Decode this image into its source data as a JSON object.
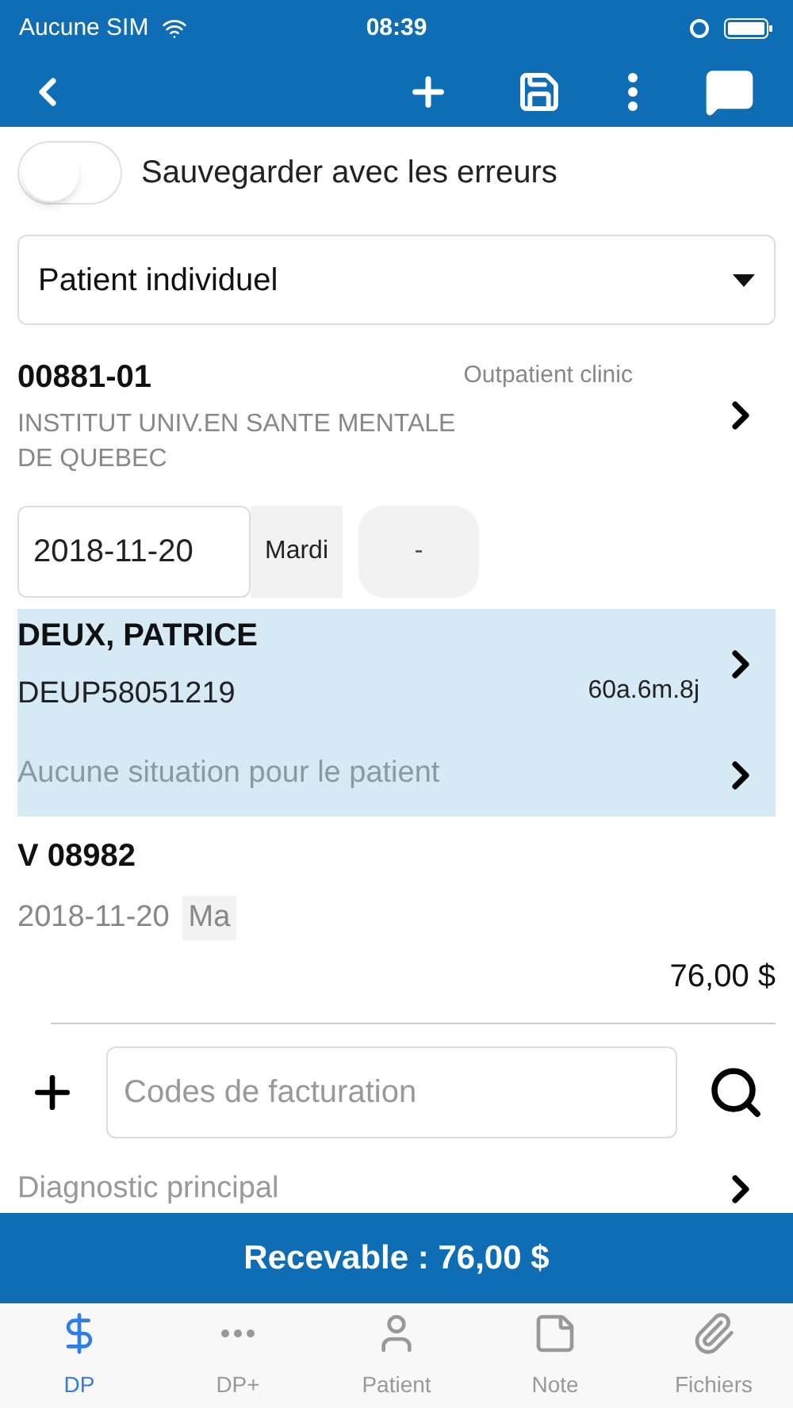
{
  "status_bar": {
    "carrier": "Aucune SIM",
    "time": "08:39"
  },
  "toggle": {
    "label": "Sauvegarder avec les erreurs",
    "on": false
  },
  "dropdown": {
    "value": "Patient individuel"
  },
  "establishment": {
    "code": "00881-01",
    "type": "Outpatient clinic",
    "name": "INSTITUT UNIV.EN SANTE MENTALE\nDE QUEBEC"
  },
  "date": {
    "value": "2018-11-20",
    "weekday": "Mardi",
    "slot": "-"
  },
  "patient": {
    "name": "DEUX, PATRICE",
    "id": "DEUP58051219",
    "age": "60a.6m.8j",
    "situation_placeholder": "Aucune situation pour le patient"
  },
  "visit": {
    "number": "V 08982",
    "date": "2018-11-20",
    "day": "Ma",
    "amount": "76,00 $"
  },
  "billing_codes": {
    "placeholder": "Codes de facturation"
  },
  "diagnosis": {
    "placeholder": "Diagnostic principal"
  },
  "total_bar": {
    "label": "Recevable : 76,00 $"
  },
  "tabs": [
    {
      "label": "DP",
      "selected": true,
      "kind": "dollar"
    },
    {
      "label": "DP+",
      "selected": false,
      "kind": "dots"
    },
    {
      "label": "Patient",
      "selected": false,
      "kind": "person"
    },
    {
      "label": "Note",
      "selected": false,
      "kind": "note"
    },
    {
      "label": "Fichiers",
      "selected": false,
      "kind": "clip"
    }
  ]
}
